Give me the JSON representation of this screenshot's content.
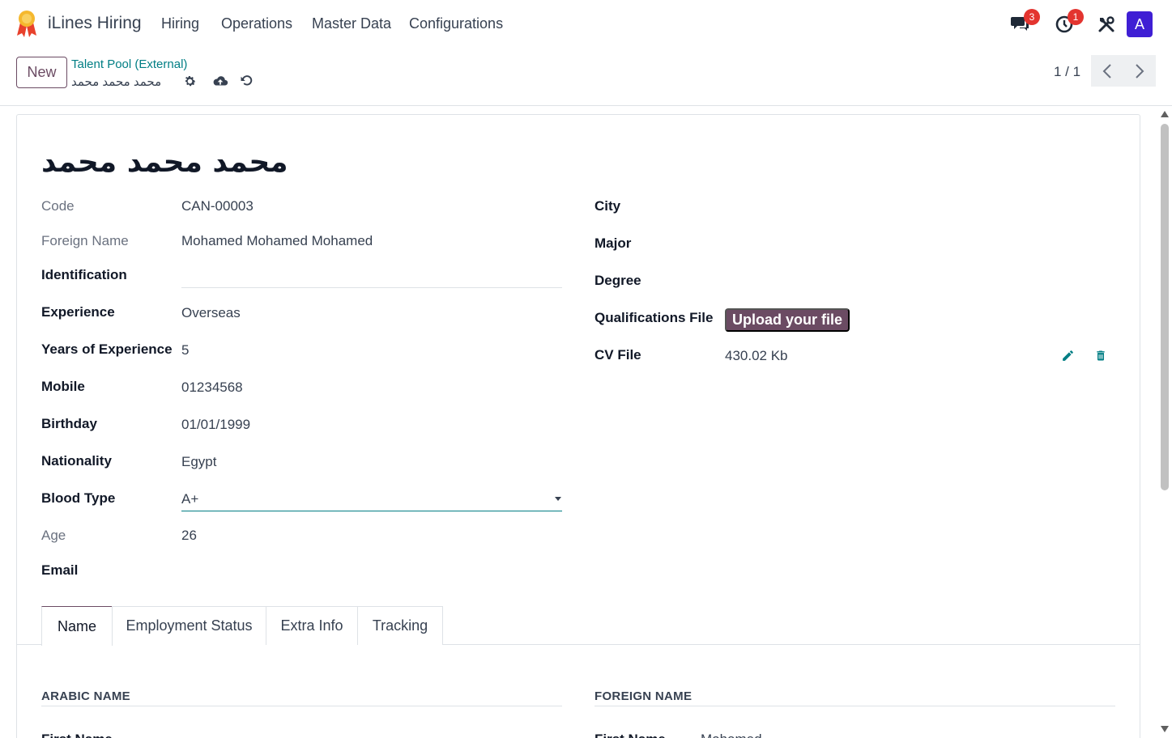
{
  "app": {
    "name": "iLines Hiring"
  },
  "menu": [
    "Hiring",
    "Operations",
    "Master Data",
    "Configurations"
  ],
  "notifications": {
    "messages_count": "3",
    "activities_count": "1",
    "avatar_letter": "A"
  },
  "control": {
    "new_label": "New",
    "breadcrumb_parent": "Talent Pool (External)",
    "breadcrumb_current": "محمد محمد محمد",
    "pager": "1 / 1"
  },
  "record": {
    "title": "محمد محمد محمد",
    "left": [
      {
        "label": "Code",
        "value": "CAN-00003"
      },
      {
        "label": "Foreign Name",
        "value": "Mohamed Mohamed Mohamed"
      },
      {
        "label": "Identification",
        "value": ""
      },
      {
        "label": "Experience",
        "value": "Overseas"
      },
      {
        "label": "Years of Experience",
        "value": "5"
      },
      {
        "label": "Mobile",
        "value": "01234568"
      },
      {
        "label": "Birthday",
        "value": "01/01/1999"
      },
      {
        "label": "Nationality",
        "value": "Egypt"
      },
      {
        "label": "Blood Type",
        "value": "A+"
      },
      {
        "label": "Age",
        "value": "26"
      },
      {
        "label": "Email",
        "value": ""
      }
    ],
    "right": [
      {
        "label": "City",
        "value": ""
      },
      {
        "label": "Major",
        "value": ""
      },
      {
        "label": "Degree",
        "value": ""
      },
      {
        "label": "Qualifications File",
        "value": ""
      },
      {
        "label": "CV File",
        "value": "430.02 Kb"
      }
    ],
    "upload_label": "Upload your file"
  },
  "tabs": [
    "Name",
    "Employment Status",
    "Extra Info",
    "Tracking"
  ],
  "sections": {
    "arabic_name": "ARABIC NAME",
    "foreign_name": "FOREIGN NAME",
    "first_name_label": "First Name",
    "foreign_first_value": "Mohamed"
  },
  "colors": {
    "brand": "#6b4b63",
    "link": "#017e84",
    "badge": "#e3342f",
    "avatar": "#3f1fd4"
  }
}
